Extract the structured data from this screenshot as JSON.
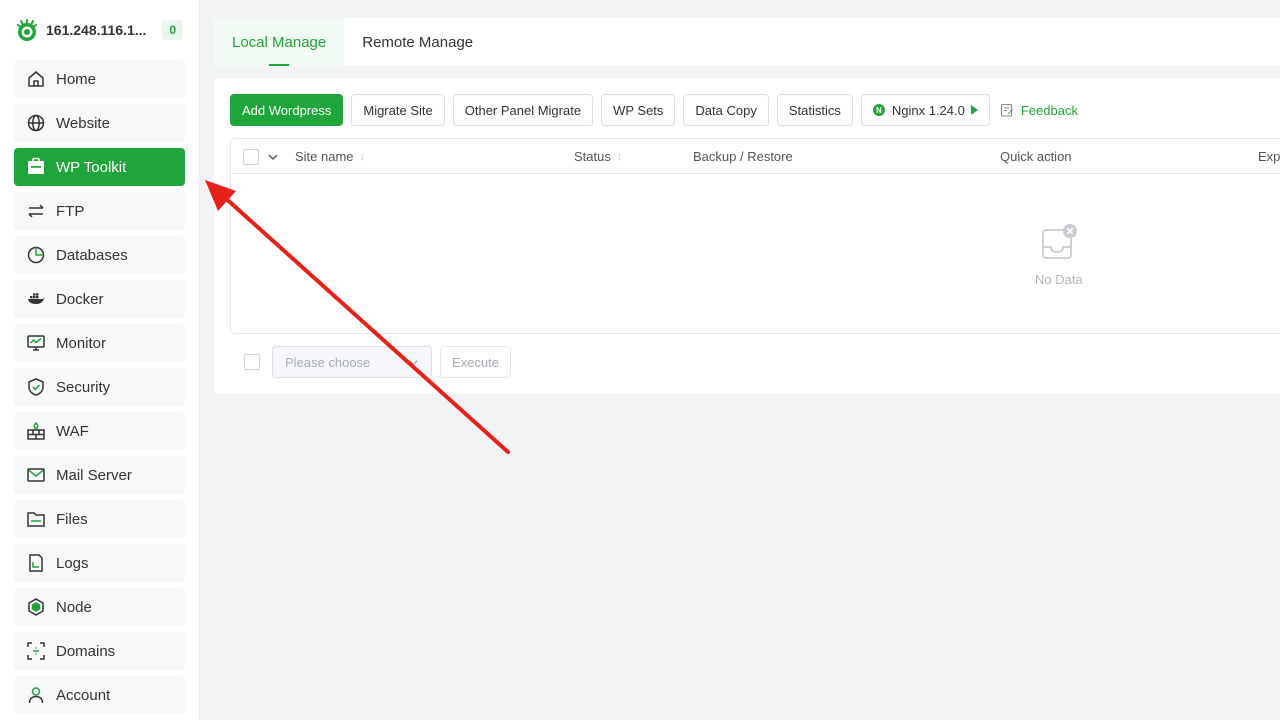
{
  "brand": {
    "ip": "161.248.116.1...",
    "badge": "0"
  },
  "sidebar": {
    "items": [
      {
        "label": "Home",
        "icon": "home-icon",
        "active": false
      },
      {
        "label": "Website",
        "icon": "globe-icon",
        "active": false
      },
      {
        "label": "WP Toolkit",
        "icon": "wordpress-toolkit-icon",
        "active": true
      },
      {
        "label": "FTP",
        "icon": "transfer-arrows-icon",
        "active": false
      },
      {
        "label": "Databases",
        "icon": "database-pie-icon",
        "active": false
      },
      {
        "label": "Docker",
        "icon": "docker-whale-icon",
        "active": false
      },
      {
        "label": "Monitor",
        "icon": "monitor-icon",
        "active": false
      },
      {
        "label": "Security",
        "icon": "shield-icon",
        "active": false
      },
      {
        "label": "WAF",
        "icon": "firewall-icon",
        "active": false
      },
      {
        "label": "Mail Server",
        "icon": "mail-icon",
        "active": false
      },
      {
        "label": "Files",
        "icon": "folder-icon",
        "active": false
      },
      {
        "label": "Logs",
        "icon": "log-file-icon",
        "active": false
      },
      {
        "label": "Node",
        "icon": "node-hex-icon",
        "active": false
      },
      {
        "label": "Domains",
        "icon": "domain-scan-icon",
        "active": false
      },
      {
        "label": "Account",
        "icon": "user-icon",
        "active": false
      }
    ]
  },
  "tabs": [
    {
      "label": "Local Manage",
      "active": true
    },
    {
      "label": "Remote Manage",
      "active": false
    }
  ],
  "toolbar": {
    "add_wordpress": "Add Wordpress",
    "migrate_site": "Migrate Site",
    "other_panel_migrate": "Other Panel Migrate",
    "wp_sets": "WP Sets",
    "data_copy": "Data Copy",
    "statistics": "Statistics",
    "nginx": "Nginx 1.24.0",
    "nginx_icon_letter": "N",
    "feedback": "Feedback"
  },
  "table": {
    "columns": {
      "site_name": "Site name",
      "status": "Status",
      "backup_restore": "Backup / Restore",
      "quick_action": "Quick action",
      "expiry": "Exp"
    },
    "empty_text": "No Data"
  },
  "batch": {
    "select_placeholder": "Please choose",
    "execute": "Execute"
  },
  "colors": {
    "accent": "#20a53a",
    "annotation_arrow": "#e8201a"
  }
}
